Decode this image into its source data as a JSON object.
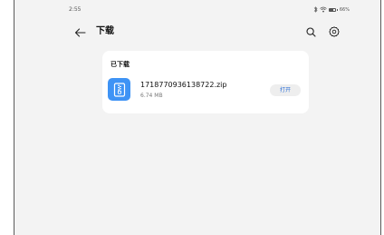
{
  "status_bar": {
    "time": "2:55",
    "battery_percent": "66%",
    "battery_level": 0.66
  },
  "toolbar": {
    "title": "下载"
  },
  "downloads": {
    "section_title": "已下载",
    "files": [
      {
        "name": "1718770936138722.zip",
        "size": "6.74 MB",
        "open_label": "打开",
        "icon": "zip-file-icon"
      }
    ]
  },
  "colors": {
    "file_icon_bg": "#3e93f5",
    "open_button_text": "#2c6fd6",
    "page_bg": "#f3f3f3",
    "card_bg": "#ffffff"
  },
  "icons": {
    "back": "back-arrow-icon",
    "search": "search-icon",
    "settings": "gear-icon",
    "bluetooth": "bluetooth-icon",
    "wifi": "wifi-icon",
    "battery": "battery-icon"
  }
}
